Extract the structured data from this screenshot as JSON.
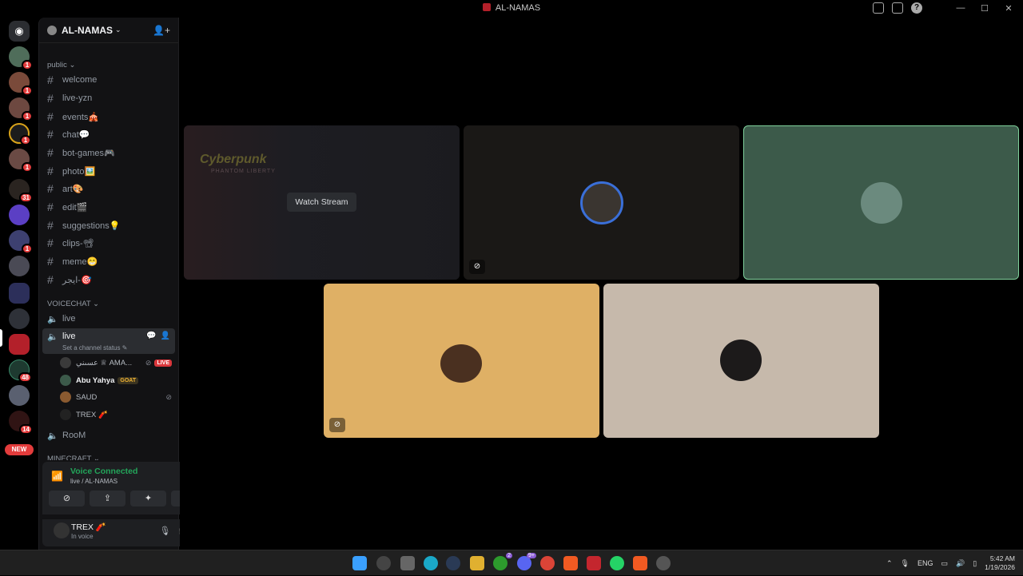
{
  "window": {
    "title": "AL-NAMAS",
    "controls": {
      "minimize": "—",
      "maximize": "☐",
      "close": "✕"
    },
    "help": "?"
  },
  "rail": {
    "badges": [
      "1",
      "1",
      "1",
      "1",
      "1",
      "31",
      "1",
      "48",
      "14"
    ],
    "new_label": "NEW"
  },
  "server": {
    "name": "AL-NAMAS",
    "categories": {
      "public": "public ⌄",
      "voicechat": "VOICECHAT ⌄",
      "minecraft": "MINECRAFT ⌄"
    },
    "text_channels": [
      "welcome",
      "live-yzn",
      "events🎪",
      "chat💬",
      "bot-games🎮",
      "photo🖼️",
      "art🎨",
      "edit🎬",
      "suggestions💡",
      "clips-📽",
      "meme😁",
      "ايجر-🎯"
    ],
    "voice_channels": {
      "first": "live",
      "active": "live",
      "active_status": "Set a channel status ✎",
      "last": "RooM"
    },
    "voice_users": [
      {
        "name": "عسىني ♕ AMA...",
        "badge": "LIVE"
      },
      {
        "name": "Abu Yahya",
        "badge": "GOAT"
      },
      {
        "name": "SAUD"
      },
      {
        "name": "TREX 🧨"
      }
    ]
  },
  "voice": {
    "status": "Voice Connected",
    "location": "live / AL-NAMAS",
    "buttons": [
      "camera-off",
      "share-screen",
      "activities",
      "soundboard"
    ]
  },
  "user": {
    "name": "TREX 🧨",
    "status": "In voice"
  },
  "stage": {
    "watch_label": "Watch Stream",
    "stream_preview_text": "Cyberpunk",
    "stream_preview_sub": "PHANTOM LIBERTY"
  },
  "taskbar": {
    "lang": "ENG",
    "time": "5:42 AM",
    "date": "1/19/2026",
    "xbox_badge": "2",
    "discord_badge": "9+"
  },
  "colors": {
    "tile_green": "#3c5a4a",
    "tile_orange": "#dfb065",
    "tile_beige": "#c6b9ab",
    "tile_dark": "#1a1816",
    "speaking_outline": "#7fd19c"
  }
}
